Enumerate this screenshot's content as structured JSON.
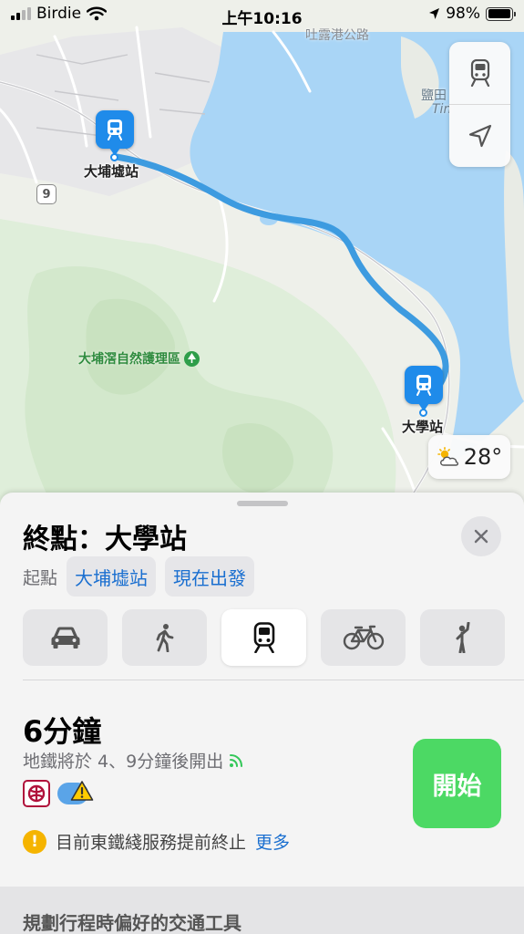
{
  "status_bar": {
    "carrier": "Birdie",
    "time": "上午10:16",
    "battery": "98%",
    "battery_level": 0.98
  },
  "map": {
    "origin_station": "大埔墟站",
    "destination_station": "大學站",
    "park_label": "大埔滘自然護理區",
    "road_number": "9",
    "faint_labels": [
      "吐露港公路",
      "鹽田",
      "Tin"
    ],
    "route_color": "#3d9be0",
    "water_color": "#a9d5f6",
    "weather_temp": "28°",
    "icons": [
      "transit-icon",
      "location-arrow-icon",
      "partly-cloudy-icon"
    ]
  },
  "sheet": {
    "title": "終點：大學站",
    "origin_label": "起點",
    "origin_value": "大埔墟站",
    "depart_value": "現在出發",
    "modes": [
      {
        "name": "drive",
        "icon": "car-icon",
        "active": false
      },
      {
        "name": "walk",
        "icon": "walk-icon",
        "active": false
      },
      {
        "name": "transit",
        "icon": "train-icon",
        "active": true
      },
      {
        "name": "cycle",
        "icon": "bicycle-icon",
        "active": false
      },
      {
        "name": "ride",
        "icon": "hail-icon",
        "active": false
      }
    ],
    "route": {
      "duration": "6分鐘",
      "subtitle": "地鐵將於 4、9分鐘後開出",
      "start_label": "開始"
    },
    "notice": {
      "text": "目前東鐵綫服務提前終止",
      "more_label": "更多"
    },
    "preference_label": "規劃行程時偏好的交通工具"
  },
  "colors": {
    "accent": "#1a6fd0",
    "start_green": "#4cd964",
    "warning": "#f5b400",
    "mtr_red": "#b0123b"
  }
}
